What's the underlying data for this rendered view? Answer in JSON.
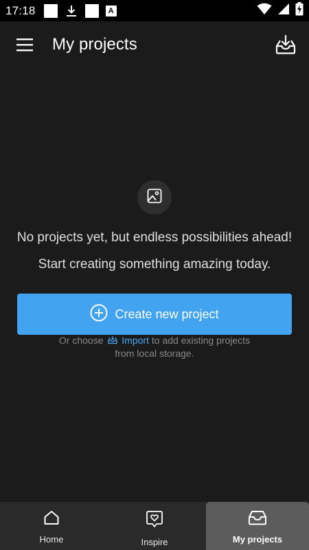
{
  "status_bar": {
    "time": "17:18",
    "notification_letter": "A"
  },
  "app_bar": {
    "title": "My projects"
  },
  "empty_state": {
    "title": "No projects yet, but endless possibilities ahead!",
    "subtitle": "Start creating something amazing today.",
    "create_button_label": "Create new project",
    "hint_prefix": "Or choose",
    "hint_link": "Import",
    "hint_suffix": "to add existing projects",
    "hint_line2": "from local storage."
  },
  "bottom_nav": {
    "items": [
      {
        "label": "Home",
        "icon": "home-icon",
        "active": false
      },
      {
        "label": "Inspire",
        "icon": "heart-bubble-icon",
        "active": false
      },
      {
        "label": "My projects",
        "icon": "inbox-icon",
        "active": true
      }
    ]
  },
  "colors": {
    "background": "#1b1b1b",
    "accent": "#42a3f1",
    "nav_background": "#2a2a2a",
    "nav_active": "#5c5c5c"
  }
}
